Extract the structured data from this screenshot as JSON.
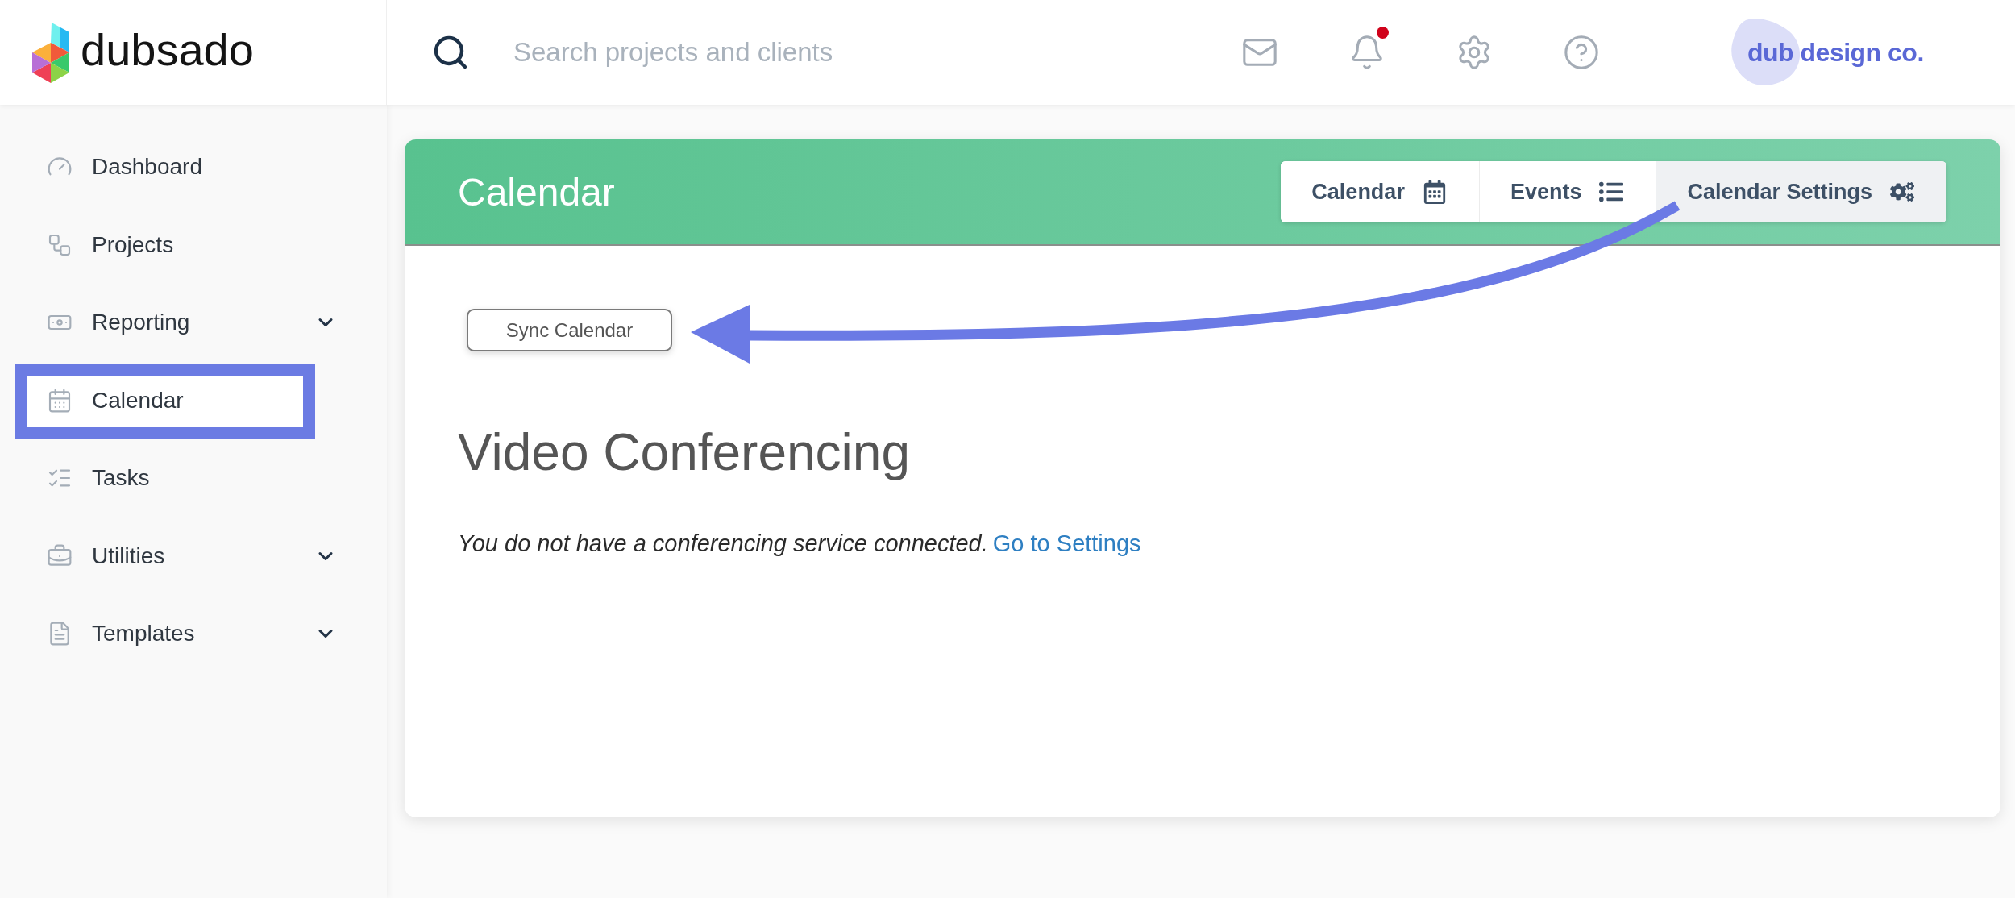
{
  "header": {
    "logo": "dubsado",
    "search": {
      "placeholder": "Search projects and clients"
    },
    "notifications": {
      "unread": true
    },
    "brand": "dub design co."
  },
  "sidebar": {
    "items": [
      {
        "label": "Dashboard",
        "expandable": false,
        "highlighted": false
      },
      {
        "label": "Projects",
        "expandable": false,
        "highlighted": false
      },
      {
        "label": "Reporting",
        "expandable": true,
        "highlighted": false
      },
      {
        "label": "Calendar",
        "expandable": false,
        "highlighted": true
      },
      {
        "label": "Tasks",
        "expandable": false,
        "highlighted": false
      },
      {
        "label": "Utilities",
        "expandable": true,
        "highlighted": false
      },
      {
        "label": "Templates",
        "expandable": true,
        "highlighted": false
      }
    ]
  },
  "calendar": {
    "title": "Calendar",
    "tabs": [
      {
        "label": "Calendar",
        "selected": false
      },
      {
        "label": "Events",
        "selected": false
      },
      {
        "label": "Calendar Settings",
        "selected": true
      }
    ],
    "sync_button": "Sync Calendar",
    "video_conferencing": {
      "title": "Video Conferencing",
      "notice": "You do not have a conferencing service connected.",
      "link": "Go to Settings"
    }
  }
}
